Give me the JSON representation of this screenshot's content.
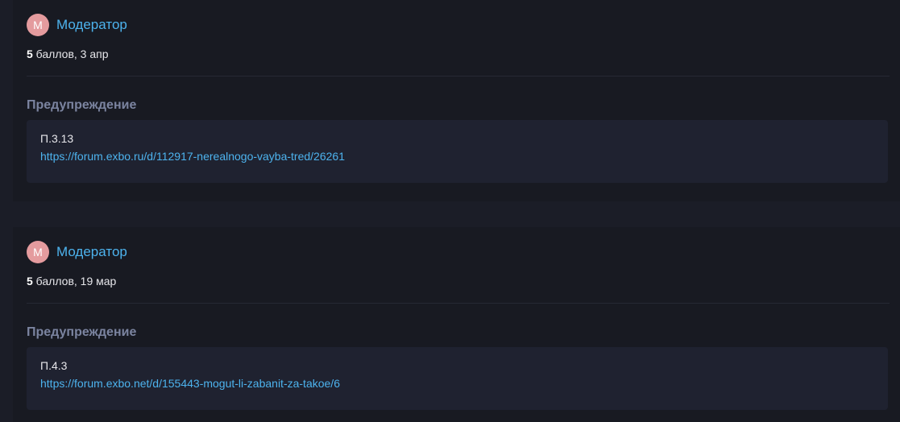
{
  "warnings": [
    {
      "avatar_letter": "M",
      "author": "Модератор",
      "points": "5",
      "meta_rest": " баллов, 3 апр",
      "title": "Предупреждение",
      "rule": "П.3.13",
      "link": "https://forum.exbo.ru/d/112917-nerealnogo-vayba-tred/26261"
    },
    {
      "avatar_letter": "M",
      "author": "Модератор",
      "points": "5",
      "meta_rest": " баллов, 19 мар",
      "title": "Предупреждение",
      "rule": "П.4.3",
      "link": "https://forum.exbo.net/d/155443-mogut-li-zabanit-za-takoe/6"
    }
  ],
  "colors": {
    "page_background": "#1b1d27",
    "card_background": "#181a22",
    "reason_background": "#1f2230",
    "avatar": "#e49b9e",
    "link": "#4db3ee",
    "title": "#7b84a0"
  }
}
